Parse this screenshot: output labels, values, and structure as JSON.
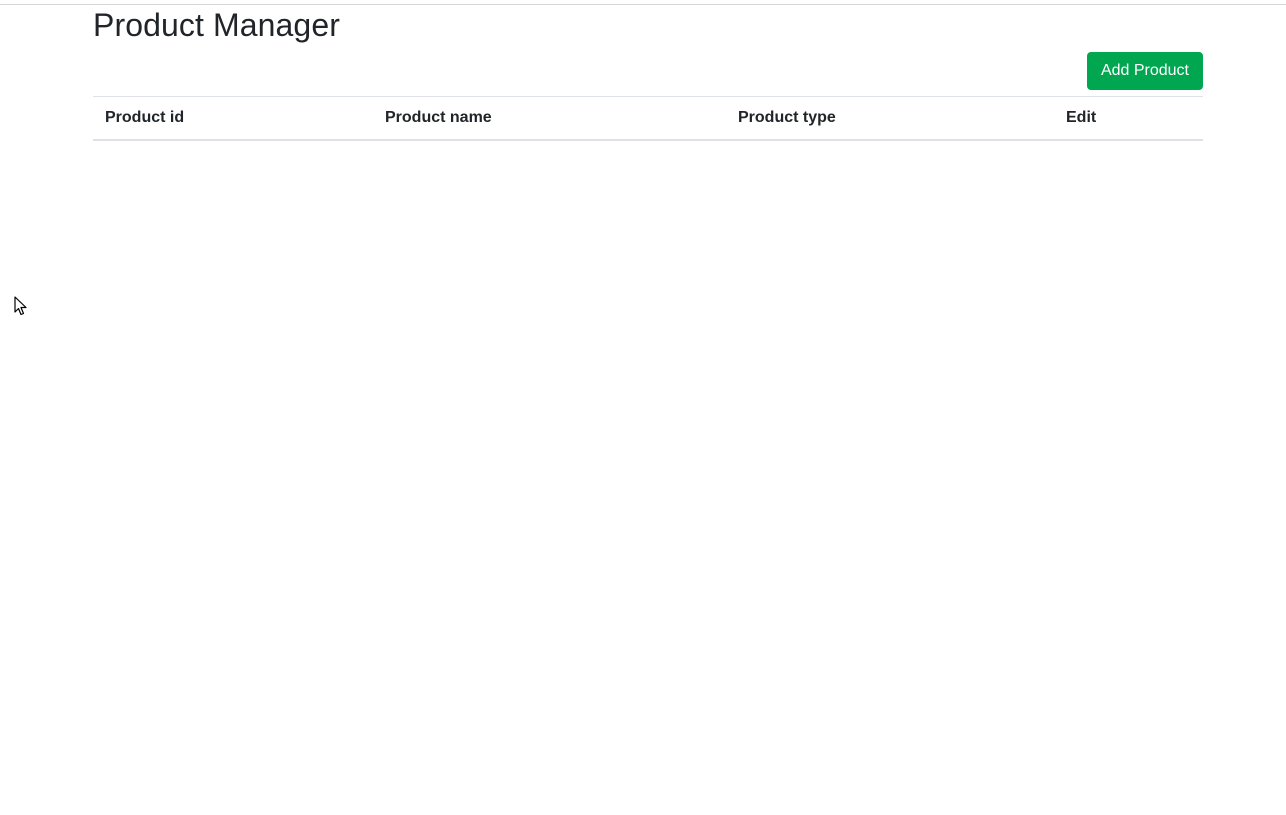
{
  "page": {
    "title": "Product Manager"
  },
  "toolbar": {
    "add_label": "Add Product"
  },
  "table": {
    "columns": [
      "Product id",
      "Product name",
      "Product type",
      "Edit"
    ],
    "rows": []
  },
  "colors": {
    "accent": "#00a650",
    "text": "#212529",
    "border": "#dee2e6"
  }
}
